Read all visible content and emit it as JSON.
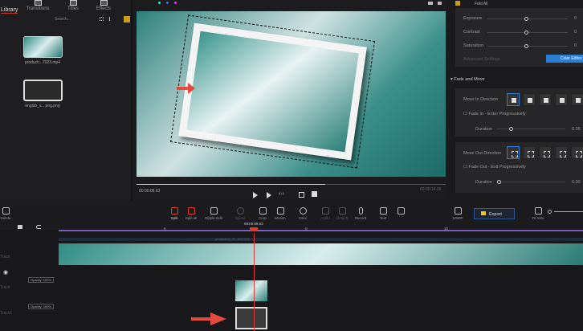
{
  "library": {
    "tabs": [
      {
        "label": "Library"
      },
      {
        "label": "Transitions"
      },
      {
        "label": "Titles"
      },
      {
        "label": "Effects"
      }
    ],
    "search_placeholder": "Search...",
    "media": [
      {
        "name": "producti...7023.mp4"
      },
      {
        "name": "englsh_v... png.png"
      }
    ]
  },
  "preview": {
    "current_time": "00:00:08.63",
    "total_time": "00:00:14.06",
    "progress": 0.61
  },
  "right_panel": {
    "fold_all": "Fold All",
    "adjustments": [
      {
        "label": "Exposure",
        "value": "0"
      },
      {
        "label": "Contrast",
        "value": "0"
      },
      {
        "label": "Saturation",
        "value": "0"
      }
    ],
    "advanced": "Advanced Settings",
    "color_editor": "Color Editor",
    "section": "Fade and Move",
    "move_in": "Move In Direction",
    "fade_in": "Fade In - Enter Progressively",
    "duration_label": "Duration",
    "duration_in": "0.05",
    "move_out": "Move Out Direction",
    "fade_out": "Fade Out - Exit Progressively",
    "duration_out": "0.00"
  },
  "toolbar": {
    "delete": "Delete",
    "split": "Split",
    "split_all": "Split all",
    "ripple": "Ripple Edit",
    "speed": "Speed",
    "crop": "Crop",
    "motion": "Motion",
    "color": "Color",
    "audio": "Audio",
    "detach": "Detach",
    "record": "Record",
    "text": "Text",
    "resolution": "1080P",
    "export": "Export",
    "fit": "Fit Size"
  },
  "timeline": {
    "playhead_time": "00:00:08.63",
    "ruler": [
      "5",
      "0",
      "10"
    ],
    "clip_name": "production_ID_4827023",
    "opacity1": "Opacity: 100%",
    "opacity2": "Opacity: 100%",
    "tracks": [
      "Track",
      "Track",
      "Track1"
    ]
  },
  "colors": {
    "accent": "#2a7fd4",
    "export": "#f0c419",
    "split": "#e53935",
    "playhead": "#e53935",
    "ruler": "#7b5cc4"
  }
}
